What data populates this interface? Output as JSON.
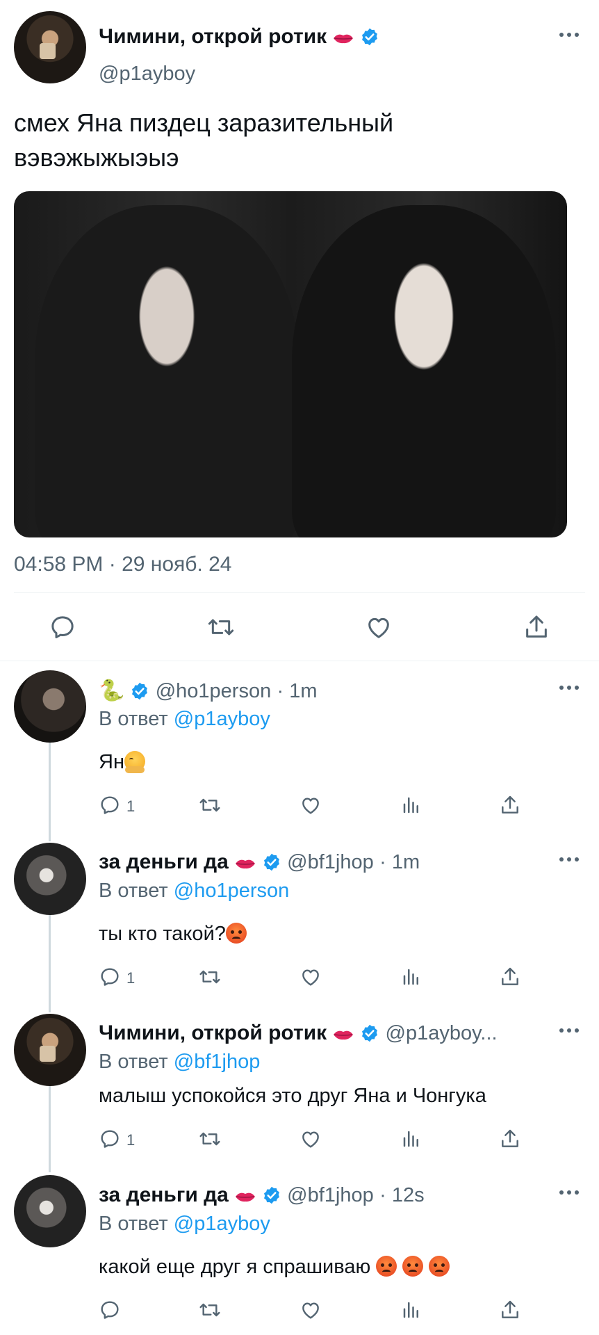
{
  "tweet": {
    "author_name": "Чимини, открой ротик",
    "author_handle": "@p1ayboy",
    "text_line1": "смех Яна пиздец заразительный",
    "text_line2": "вэвэжыжыэыэ",
    "timestamp": "04:58 PM · 29 нояб. 24"
  },
  "colors": {
    "accent": "#1d9bf0",
    "secondary_text": "#536471",
    "divider": "#eff3f4"
  },
  "replies": [
    {
      "name": "🐍",
      "handle": "@ho1person",
      "time": "· 1m",
      "reply_prefix": "В ответ",
      "reply_to": "@p1ayboy",
      "text": "Ян",
      "emoji": "hugging-face",
      "reply_count": "1"
    },
    {
      "name": "за деньги да",
      "handle": "@bf1jhop",
      "time": "· 1m",
      "reply_prefix": "В ответ",
      "reply_to": "@ho1person",
      "text": "ты кто такой?",
      "emoji": "angry-face",
      "reply_count": "1"
    },
    {
      "name": "Чимини, открой ротик",
      "handle": "@p1ayboy...",
      "time": "",
      "reply_prefix": "В ответ",
      "reply_to": "@bf1jhop",
      "text": "малыш успокойся это друг Яна и Чонгука",
      "emoji": "",
      "reply_count": "1"
    },
    {
      "name": "за деньги да",
      "handle": "@bf1jhop",
      "time": "· 12s",
      "reply_prefix": "В ответ",
      "reply_to": "@p1ayboy",
      "text": "какой еще друг я спрашиваю",
      "emoji": "angry-face x3",
      "reply_count": ""
    }
  ]
}
